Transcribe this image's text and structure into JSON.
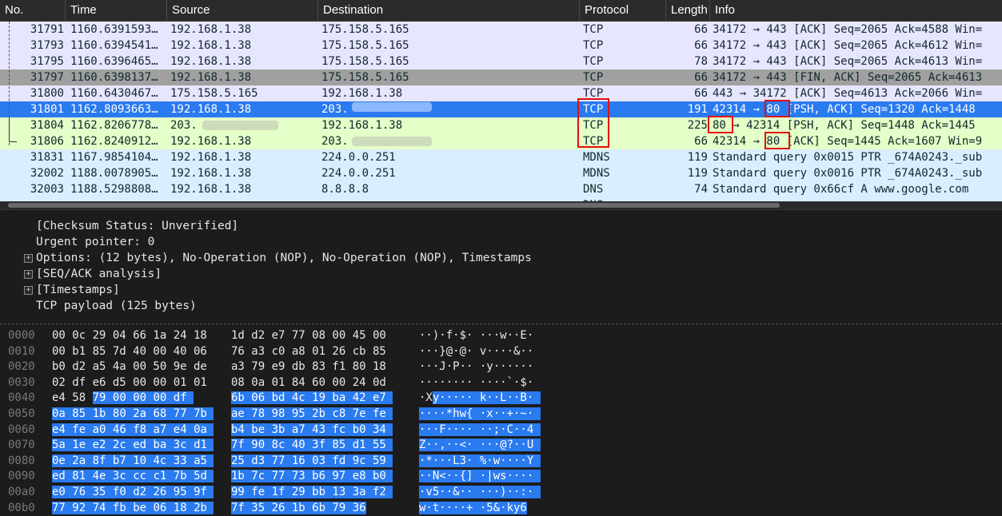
{
  "columns": {
    "no": "No.",
    "time": "Time",
    "source": "Source",
    "destination": "Destination",
    "protocol": "Protocol",
    "length": "Length",
    "info": "Info"
  },
  "packets": [
    {
      "no": "31791",
      "time": "1160.6391593…",
      "source": "192.168.1.38",
      "destination": "175.158.5.165",
      "protocol": "TCP",
      "length": "66",
      "info": "34172 → 443 [ACK] Seq=2065 Ack=4588 Win=",
      "bg": "#e7e6ff"
    },
    {
      "no": "31793",
      "time": "1160.6394541…",
      "source": "192.168.1.38",
      "destination": "175.158.5.165",
      "protocol": "TCP",
      "length": "66",
      "info": "34172 → 443 [ACK] Seq=2065 Ack=4612 Win=",
      "bg": "#e7e6ff"
    },
    {
      "no": "31795",
      "time": "1160.6396465…",
      "source": "192.168.1.38",
      "destination": "175.158.5.165",
      "protocol": "TCP",
      "length": "78",
      "info": "34172 → 443 [ACK] Seq=2065 Ack=4613 Win=",
      "bg": "#e7e6ff"
    },
    {
      "no": "31797",
      "time": "1160.6398137…",
      "source": "192.168.1.38",
      "destination": "175.158.5.165",
      "protocol": "TCP",
      "length": "66",
      "info": "34172 → 443 [FIN, ACK] Seq=2065 Ack=4613",
      "bg": "#a0a0a0"
    },
    {
      "no": "31800",
      "time": "1160.6430467…",
      "source": "175.158.5.165",
      "destination": "192.168.1.38",
      "protocol": "TCP",
      "length": "66",
      "info": "443 → 34172 [ACK] Seq=4613 Ack=2066 Win=",
      "bg": "#e7e6ff"
    },
    {
      "no": "31801",
      "time": "1162.8093663…",
      "source": "192.168.1.38",
      "destination": "203.",
      "protocol": "TCP",
      "length": "191",
      "info": "42314 → 80 [PSH, ACK] Seq=1320 Ack=1448",
      "bg": "#2a7af0",
      "selected": true
    },
    {
      "no": "31804",
      "time": "1162.8206778…",
      "source": "203.",
      "destination": "192.168.1.38",
      "protocol": "TCP",
      "length": "225",
      "info": "80 → 42314 [PSH, ACK] Seq=1448 Ack=1445",
      "bg": "#e4ffc7"
    },
    {
      "no": "31806",
      "time": "1162.8240912…",
      "source": "192.168.1.38",
      "destination": "203.",
      "protocol": "TCP",
      "length": "66",
      "info": "42314 → 80 [ACK] Seq=1445 Ack=1607 Win=9",
      "bg": "#e4ffc7"
    },
    {
      "no": "31831",
      "time": "1167.9854104…",
      "source": "192.168.1.38",
      "destination": "224.0.0.251",
      "protocol": "MDNS",
      "length": "119",
      "info": "Standard query 0x0015 PTR _674A0243._sub",
      "bg": "#daeeff"
    },
    {
      "no": "32002",
      "time": "1188.0078905…",
      "source": "192.168.1.38",
      "destination": "224.0.0.251",
      "protocol": "MDNS",
      "length": "119",
      "info": "Standard query 0x0016 PTR _674A0243._sub",
      "bg": "#daeeff"
    },
    {
      "no": "32003",
      "time": "1188.5298808…",
      "source": "192.168.1.38",
      "destination": "8.8.8.8",
      "protocol": "DNS",
      "length": "74",
      "info": "Standard query 0x66cf A www.google.com",
      "bg": "#daeeff"
    },
    {
      "no": "",
      "time": "",
      "source": "",
      "destination": "",
      "protocol": "DNS",
      "length": "",
      "info": "",
      "bg": "#daeeff"
    }
  ],
  "details": [
    {
      "text": "[Checksum Status: Unverified]",
      "expandable": false
    },
    {
      "text": "Urgent pointer: 0",
      "expandable": false
    },
    {
      "text": "Options: (12 bytes), No-Operation (NOP), No-Operation (NOP), Timestamps",
      "expandable": true
    },
    {
      "text": "[SEQ/ACK analysis]",
      "expandable": true
    },
    {
      "text": "[Timestamps]",
      "expandable": true
    },
    {
      "text": "TCP payload (125 bytes)",
      "expandable": false
    }
  ],
  "hexdump": [
    {
      "offset": "0000",
      "hex1": "00 0c 29 04 66 1a 24 18",
      "hex2": "1d d2 e7 77 08 00 45 00",
      "ascii": "··)·f·$· ···w··E·",
      "hl_start_hex": -1,
      "hl_start_ascii": -1
    },
    {
      "offset": "0010",
      "hex1": "00 b1 85 7d 40 00 40 06",
      "hex2": "76 a3 c0 a8 01 26 cb 85",
      "ascii": "···}@·@· v····&··",
      "hl_start_hex": -1,
      "hl_start_ascii": -1
    },
    {
      "offset": "0020",
      "hex1": "b0 d2 a5 4a 00 50 9e de",
      "hex2": "a3 79 e9 db 83 f1 80 18",
      "ascii": "···J·P·· ·y······",
      "hl_start_hex": -1,
      "hl_start_ascii": -1
    },
    {
      "offset": "0030",
      "hex1": "02 df e6 d5 00 00 01 01",
      "hex2": "08 0a 01 84 60 00 24 0d",
      "ascii": "········ ····`·$·",
      "hl_start_hex": -1,
      "hl_start_ascii": -1
    },
    {
      "offset": "0040",
      "hex1": "e4 58 79 00 00 00 df",
      "hex2": "6b 06 bd 4c 19 ba 42 e7",
      "ascii": "·Xy····· k··L··B·",
      "hl_start_hex": 2,
      "hl_start_ascii": 2
    },
    {
      "offset": "0050",
      "hex1": "0a 85 1b 80 2a 68 77 7b",
      "hex2": "ae 78 98 95 2b c8 7e fe",
      "ascii": "····*hw{ ·x··+·~·",
      "hl_start_hex": 0,
      "hl_start_ascii": 0
    },
    {
      "offset": "0060",
      "hex1": "e4 fe a0 46 f8 a7 e4 0a",
      "hex2": "b4 be 3b a7 43 fc b0 34",
      "ascii": "···F···· ··;·C··4",
      "hl_start_hex": 0,
      "hl_start_ascii": 0
    },
    {
      "offset": "0070",
      "hex1": "5a 1e e2 2c ed ba 3c d1",
      "hex2": "7f 90 8c 40 3f 85 d1 55",
      "ascii": "Z··,··<· ···@?··U",
      "hl_start_hex": 0,
      "hl_start_ascii": 0
    },
    {
      "offset": "0080",
      "hex1": "0e 2a 8f b7 10 4c 33 a5",
      "hex2": "25 d3 77 16 03 fd 9c 59",
      "ascii": "·*···L3· %·w····Y",
      "hl_start_hex": 0,
      "hl_start_ascii": 0
    },
    {
      "offset": "0090",
      "hex1": "ed 81 4e 3c cc c1 7b 5d",
      "hex2": "1b 7c 77 73 b6 97 e8 b0",
      "ascii": "··N<··{] ·|ws····",
      "hl_start_hex": 0,
      "hl_start_ascii": 0
    },
    {
      "offset": "00a0",
      "hex1": "e0 76 35 f0 d2 26 95 9f",
      "hex2": "99 fe 1f 29 bb 13 3a f2",
      "ascii": "·v5··&·· ···)··:·",
      "hl_start_hex": 0,
      "hl_start_ascii": 0
    },
    {
      "offset": "00b0",
      "hex1": "77 92 74 fb be 06 18 2b",
      "hex2": "7f 35 26 1b 6b 79 36",
      "ascii": "w·t····+ ·5&·ky6",
      "hl_start_hex": 0,
      "hl_start_ascii": 0
    }
  ],
  "colors": {
    "selected": "#2a7af0",
    "tcp_bg": "#e7e6ff",
    "http_bg": "#e4ffc7",
    "udp_bg": "#daeeff",
    "fin_bg": "#a0a0a0",
    "annotation_red": "#e01010"
  },
  "icons": {
    "expander": "plus-box-icon",
    "tree": "conversation-bracket-icon"
  }
}
